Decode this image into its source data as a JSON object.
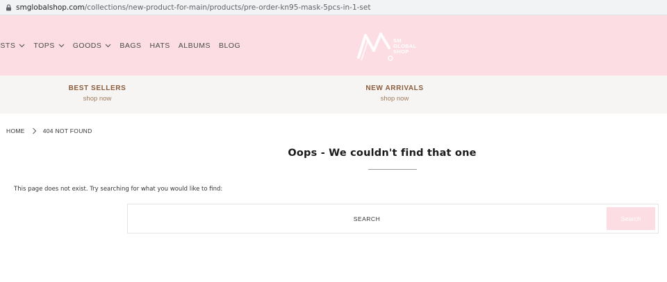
{
  "browser": {
    "url_host": "smglobalshop.com",
    "url_path": "/collections/new-product-for-main/products/pre-order-kn95-mask-5pcs-in-1-set"
  },
  "header": {
    "nav": [
      {
        "label": "ISTS",
        "has_dropdown": true
      },
      {
        "label": "TOPS",
        "has_dropdown": true
      },
      {
        "label": "GOODS",
        "has_dropdown": true
      },
      {
        "label": "BAGS",
        "has_dropdown": false
      },
      {
        "label": "HATS",
        "has_dropdown": false
      },
      {
        "label": "ALBUMS",
        "has_dropdown": false
      },
      {
        "label": "BLOG",
        "has_dropdown": false
      }
    ],
    "logo": {
      "line1": "SM",
      "line2": "GLOBAL",
      "line3": "SHOP"
    },
    "background": "#fbdde3"
  },
  "promo": {
    "best_sellers": {
      "title": "BEST SELLERS",
      "sub": "shop now"
    },
    "new_arrivals": {
      "title": "NEW ARRIVALS",
      "sub": "shop now"
    }
  },
  "breadcrumb": {
    "home": "HOME",
    "current": "404 NOT FOUND"
  },
  "main": {
    "title": "Oops - We couldn't find that one",
    "message": "This page does not exist. Try searching for what you would like to find:",
    "search": {
      "placeholder": "SEARCH",
      "button_label": "Search"
    }
  },
  "colors": {
    "accent_pink": "#fbdde3",
    "promo_brown": "#8a5a3a"
  }
}
